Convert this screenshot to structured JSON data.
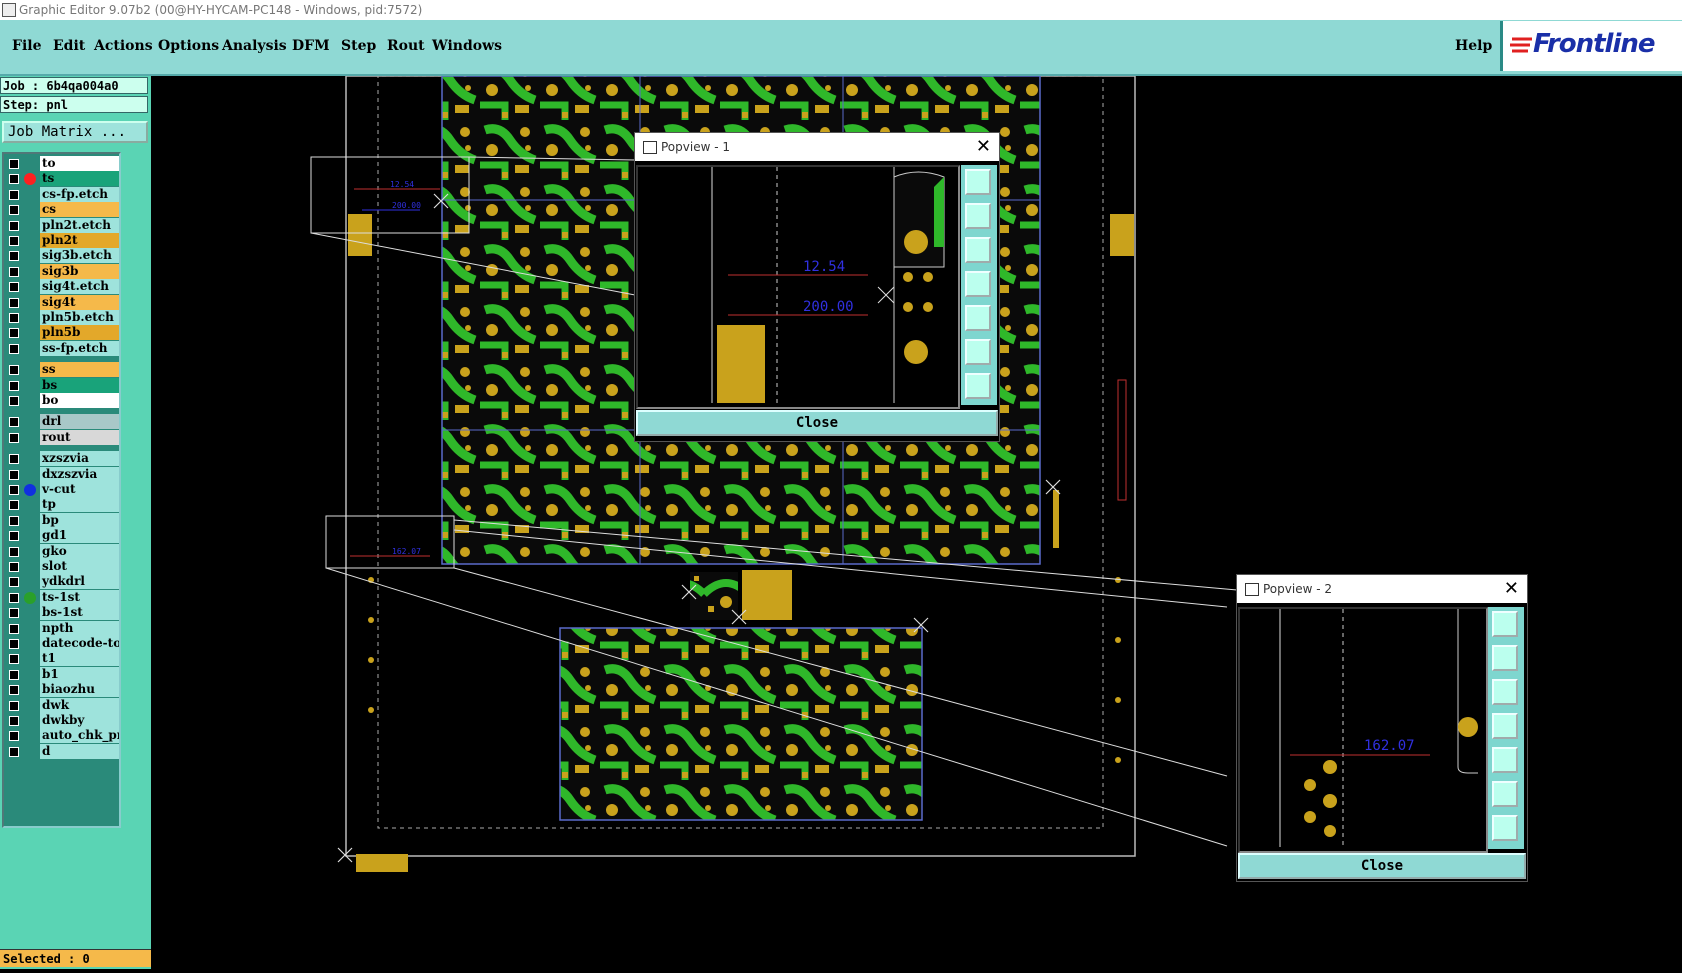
{
  "window": {
    "title": "Graphic Editor 9.07b2 (00@HY-HYCAM-PC148 - Windows, pid:7572)"
  },
  "menu": {
    "items": [
      "File",
      "Edit",
      "Actions",
      "Options",
      "Analysis",
      "DFM",
      "Step",
      "Rout",
      "Windows"
    ],
    "help": "Help",
    "logo": "Frontline"
  },
  "left_panel": {
    "job": "Job :  6b4qa004a0",
    "step": "Step: pnl",
    "job_matrix": "Job Matrix ...",
    "selected": "Selected : 0",
    "layers": [
      {
        "name": "to",
        "color": "#ffffff",
        "dot": ""
      },
      {
        "name": "ts",
        "color": "#19a37a",
        "dot": "#ff2020"
      },
      {
        "name": "cs-fp.etch",
        "color": "#9ee3dc",
        "dot": ""
      },
      {
        "name": "cs",
        "color": "#f5b94a",
        "dot": ""
      },
      {
        "name": "pln2t.etch",
        "color": "#9ee3dc",
        "dot": ""
      },
      {
        "name": "pln2t",
        "color": "#e3a82a",
        "dot": ""
      },
      {
        "name": "sig3b.etch",
        "color": "#9ee3dc",
        "dot": ""
      },
      {
        "name": "sig3b",
        "color": "#f5b94a",
        "dot": ""
      },
      {
        "name": "sig4t.etch",
        "color": "#9ee3dc",
        "dot": ""
      },
      {
        "name": "sig4t",
        "color": "#f5b94a",
        "dot": ""
      },
      {
        "name": "pln5b.etch",
        "color": "#9ee3dc",
        "dot": ""
      },
      {
        "name": "pln5b",
        "color": "#e3a82a",
        "dot": ""
      },
      {
        "name": "ss-fp.etch",
        "color": "#9ee3dc",
        "dot": ""
      },
      {
        "name": "ss",
        "color": "#f5b94a",
        "dot": ""
      },
      {
        "name": "bs",
        "color": "#19a37a",
        "dot": ""
      },
      {
        "name": "bo",
        "color": "#ffffff",
        "dot": ""
      },
      {
        "name": "drl",
        "color": "#a8c8c8",
        "dot": ""
      },
      {
        "name": "rout",
        "color": "#d8d8d8",
        "dot": ""
      },
      {
        "name": "xzszvia",
        "color": "#9ee3dc",
        "dot": ""
      },
      {
        "name": "dxzszvia",
        "color": "#9ee3dc",
        "dot": ""
      },
      {
        "name": "v-cut",
        "color": "#9ee3dc",
        "dot": "#1030e0"
      },
      {
        "name": "tp",
        "color": "#9ee3dc",
        "dot": ""
      },
      {
        "name": "bp",
        "color": "#9ee3dc",
        "dot": ""
      },
      {
        "name": "gd1",
        "color": "#9ee3dc",
        "dot": ""
      },
      {
        "name": "gko",
        "color": "#9ee3dc",
        "dot": ""
      },
      {
        "name": "slot",
        "color": "#9ee3dc",
        "dot": ""
      },
      {
        "name": "ydkdrl",
        "color": "#9ee3dc",
        "dot": ""
      },
      {
        "name": "ts-1st",
        "color": "#9ee3dc",
        "dot": "#2aa02a"
      },
      {
        "name": "bs-1st",
        "color": "#9ee3dc",
        "dot": ""
      },
      {
        "name": "npth",
        "color": "#9ee3dc",
        "dot": ""
      },
      {
        "name": "datecode-to",
        "color": "#9ee3dc",
        "dot": ""
      },
      {
        "name": "t1",
        "color": "#9ee3dc",
        "dot": ""
      },
      {
        "name": "b1",
        "color": "#9ee3dc",
        "dot": ""
      },
      {
        "name": "biaozhu",
        "color": "#9ee3dc",
        "dot": ""
      },
      {
        "name": "dwk",
        "color": "#9ee3dc",
        "dot": ""
      },
      {
        "name": "dwkby",
        "color": "#9ee3dc",
        "dot": ""
      },
      {
        "name": "auto_chk_pn",
        "color": "#9ee3dc",
        "dot": ""
      },
      {
        "name": "d",
        "color": "#9ee3dc",
        "dot": ""
      }
    ]
  },
  "canvas": {
    "measure_small_1": "12.54",
    "measure_small_2": "200.00",
    "measure_small_3": "162.07"
  },
  "popup1": {
    "title": "Popview - 1",
    "close": "Close",
    "measure_1": "12.54",
    "measure_2": "200.00"
  },
  "popup2": {
    "title": "Popview - 2",
    "close": "Close",
    "measure_1": "162.07"
  },
  "colors": {
    "menubar": "#8fd9d4",
    "panel": "#5ad4b4",
    "board_green": "#2fb82a",
    "board_gold": "#c9a21c"
  }
}
